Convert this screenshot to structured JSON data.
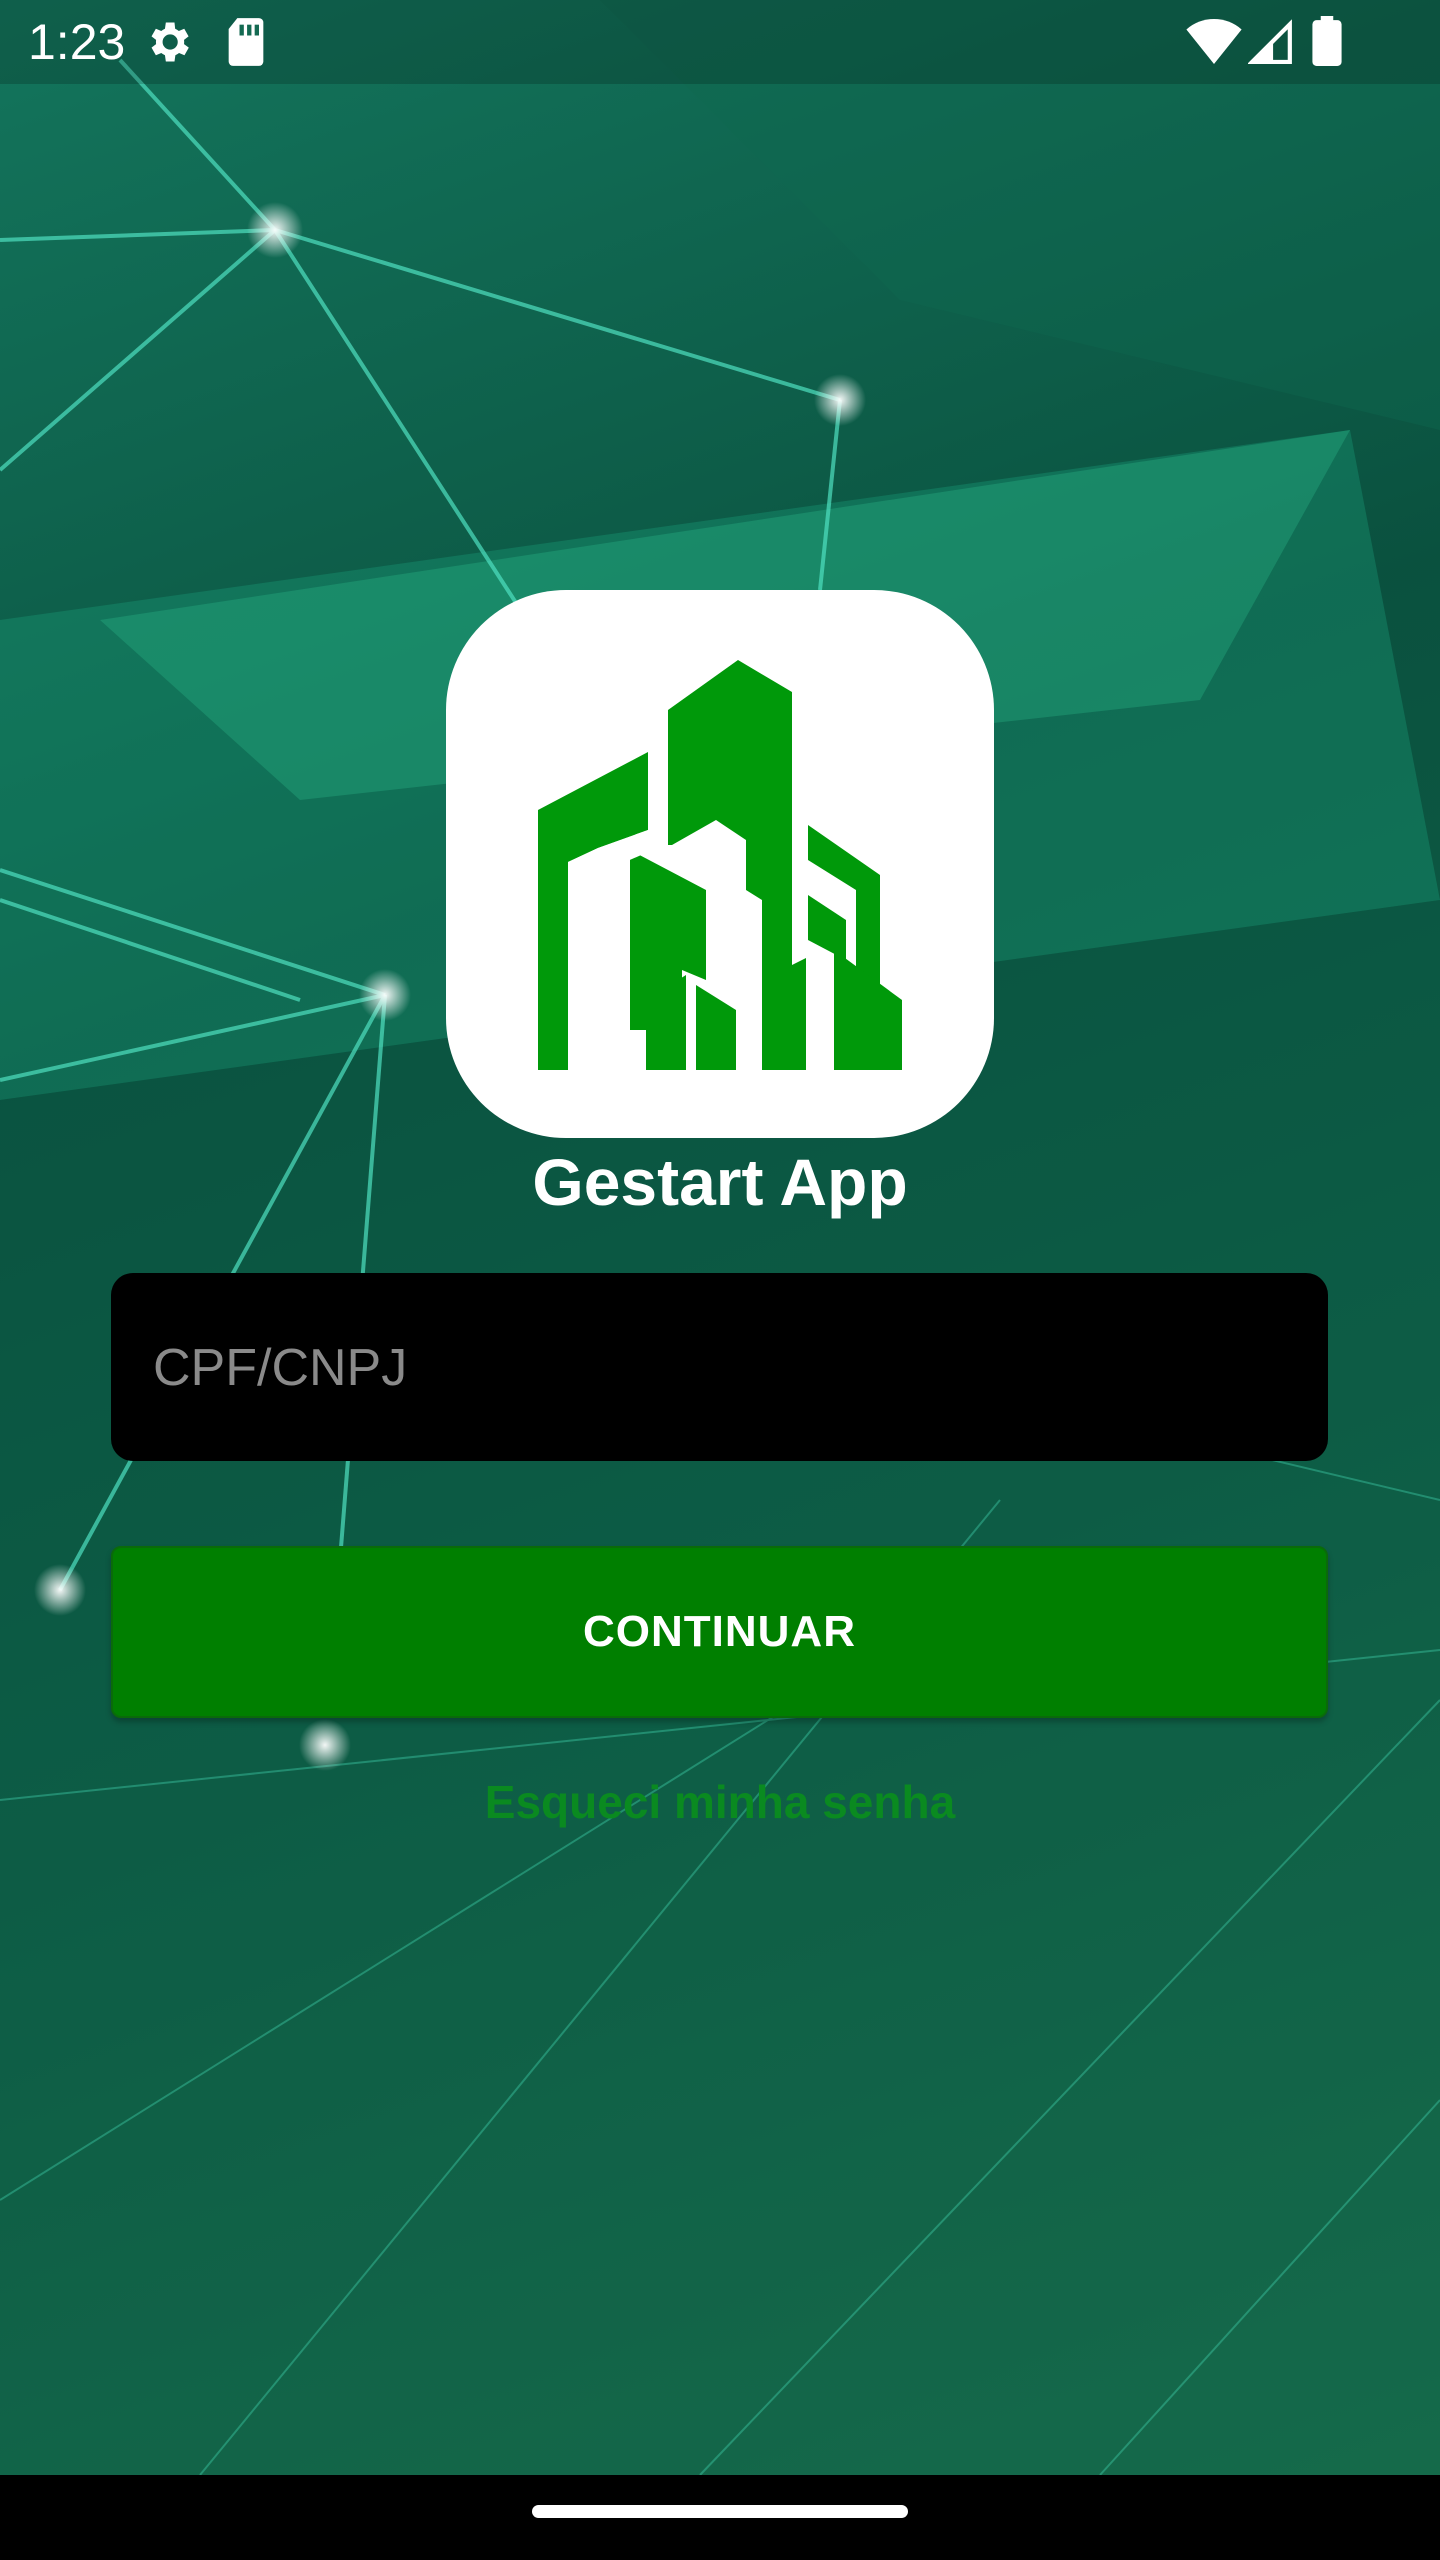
{
  "status_bar": {
    "time": "1:23",
    "icons": [
      "settings-gear-icon",
      "sd-card-icon",
      "wifi-icon",
      "cell-signal-icon",
      "battery-icon"
    ]
  },
  "app": {
    "title": "Gestart App",
    "logo": "building-logo-icon",
    "brand_color": "#00990a"
  },
  "login": {
    "document_placeholder": "CPF/CNPJ",
    "document_value": "",
    "continue_label": "CONTINUAR",
    "forgot_label": "Esqueci minha senha"
  },
  "colors": {
    "button": "#007f00",
    "link": "#0a8a20",
    "input_bg": "#000000"
  }
}
